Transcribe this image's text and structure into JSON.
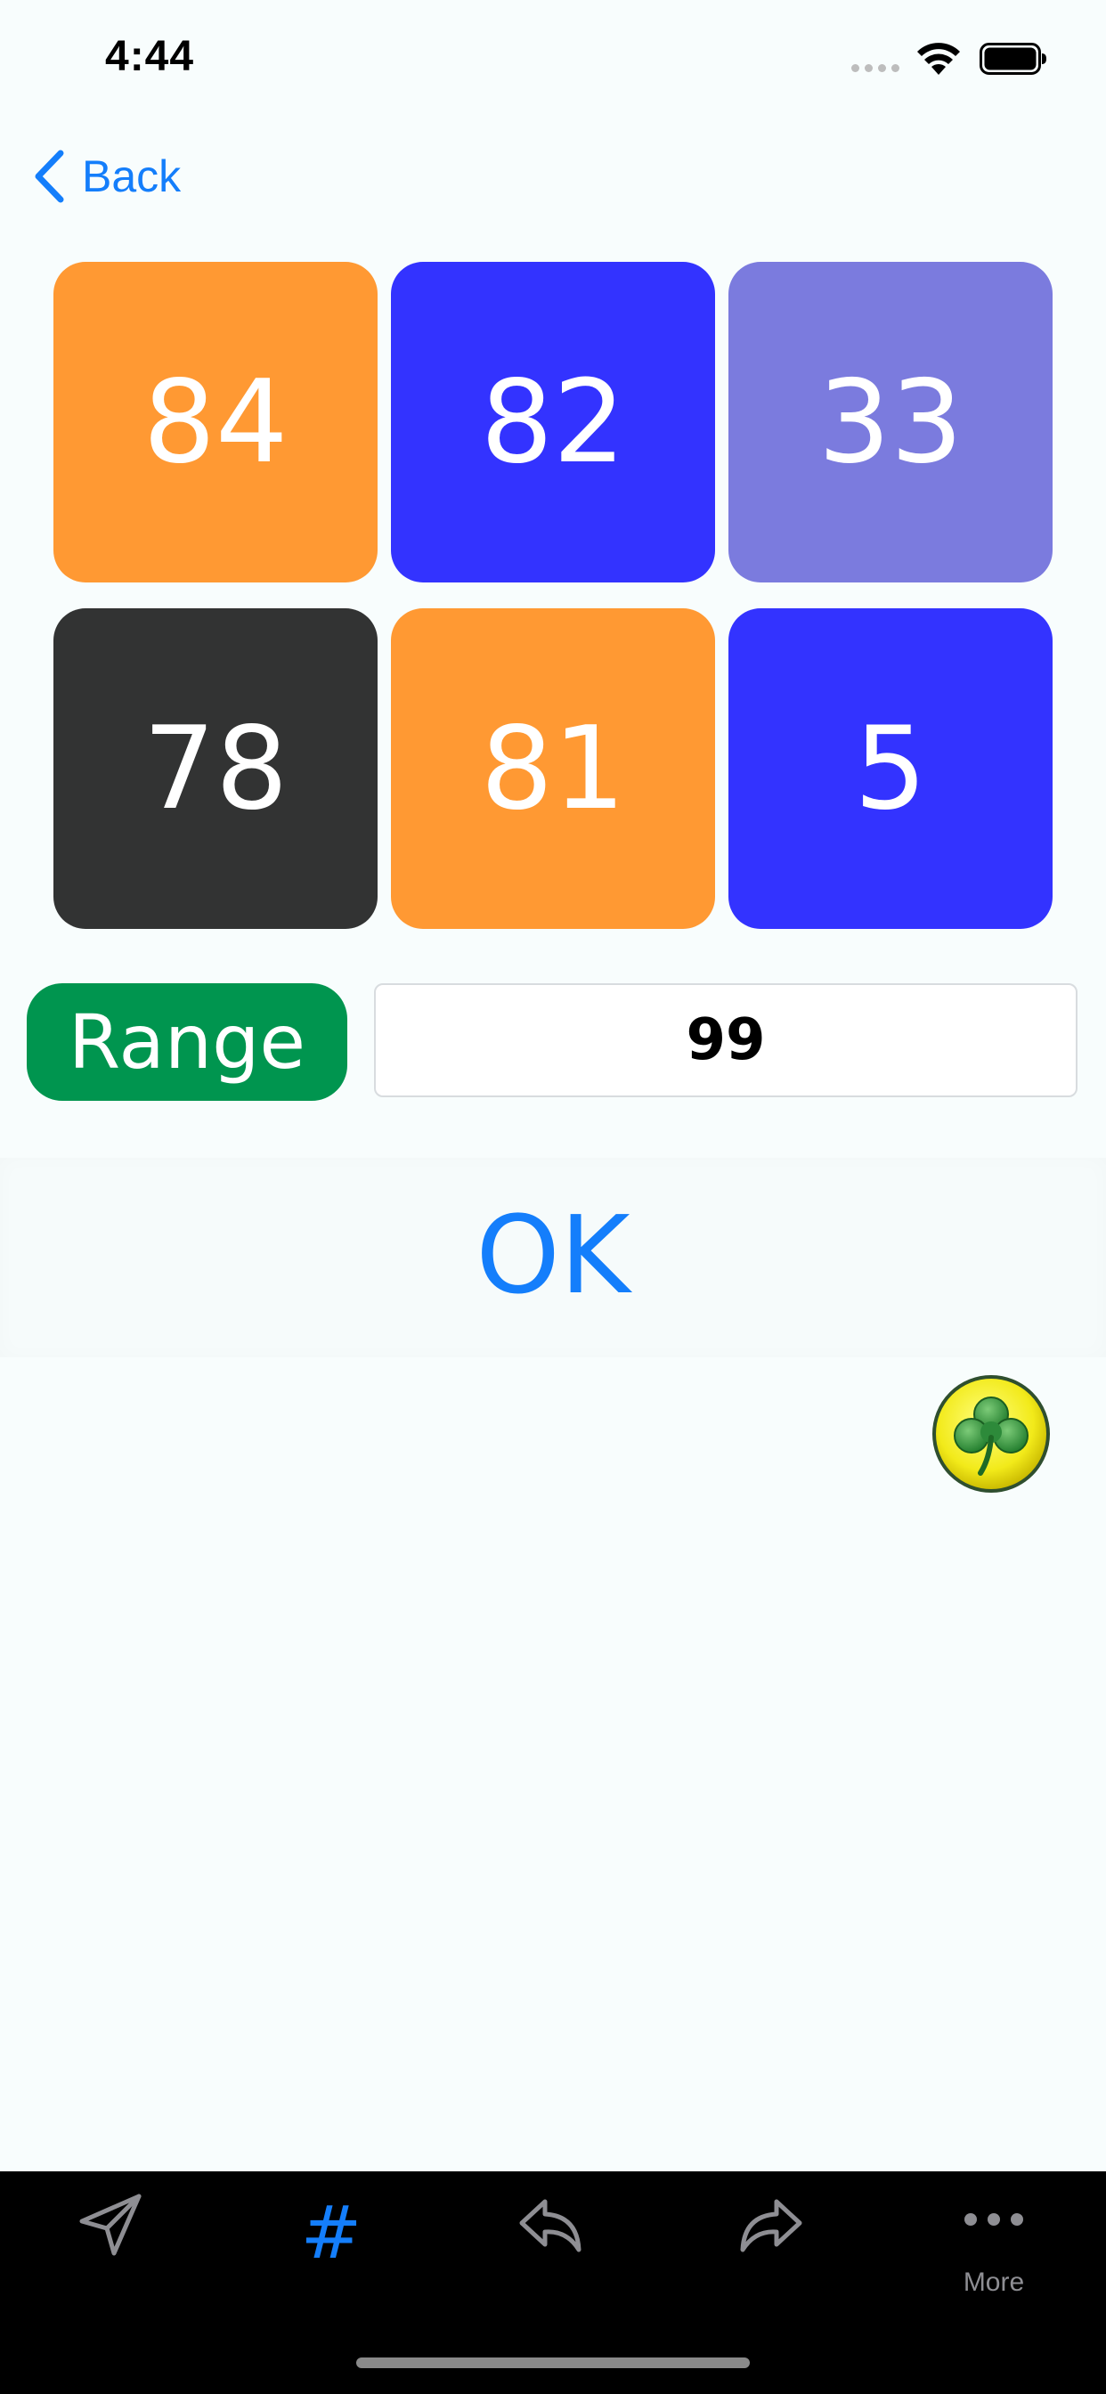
{
  "status_bar": {
    "time": "4:44"
  },
  "nav": {
    "back_label": "Back"
  },
  "tiles": [
    {
      "value": "84",
      "color": "#FF9933"
    },
    {
      "value": "82",
      "color": "#3333FF"
    },
    {
      "value": "33",
      "color": "#7B7BDE"
    },
    {
      "value": "78",
      "color": "#323333"
    },
    {
      "value": "81",
      "color": "#FF9933"
    },
    {
      "value": "5",
      "color": "#3333FF"
    }
  ],
  "range": {
    "button_label": "Range",
    "value": "99"
  },
  "ok": {
    "label": "OK"
  },
  "badge": {
    "icon": "shamrock-icon"
  },
  "tabbar": {
    "items": [
      {
        "icon": "send-icon",
        "label": ""
      },
      {
        "icon": "hashtag-icon",
        "label": "#",
        "active": true
      },
      {
        "icon": "reply-icon",
        "label": ""
      },
      {
        "icon": "forward-icon",
        "label": ""
      },
      {
        "icon": "more-icon",
        "label": "More"
      }
    ]
  },
  "colors": {
    "accent": "#147EFB",
    "range_button": "#00954F",
    "background": "#F8FDFD",
    "tabbar": "#000000"
  }
}
